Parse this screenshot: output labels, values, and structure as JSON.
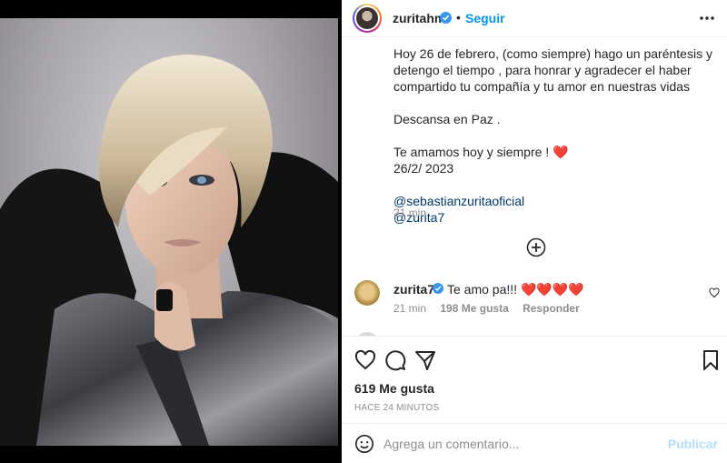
{
  "post": {
    "username": "zuritahm",
    "follow_label": "Seguir",
    "separator": "•",
    "caption": {
      "line1": "Hoy 26 de febrero, (como siempre) hago un paréntesis y detengo el tiempo , para honrar y agradecer el haber compartido tu compañía y tu amor en nuestras vidas",
      "line2": "Descansa en Paz .",
      "line3": "Te amamos hoy y siempre ! ",
      "heart": "❤️",
      "line4": "26/2/ 2023",
      "mention1": "@sebastianzuritaoficial",
      "mention2": "@zurita7"
    },
    "caption_time": "21 min"
  },
  "comment": {
    "username": "zurita7",
    "text": "Te amo pa!!! ",
    "hearts": "❤️❤️❤️❤️",
    "time": "21 min",
    "likes": "198 Me gusta",
    "reply": "Responder"
  },
  "footer": {
    "likes": "619 Me gusta",
    "ago": "HACE 24 MINUTOS",
    "comment_placeholder": "Agrega un comentario...",
    "publish": "Publicar"
  },
  "icons": {
    "verified": "verified-badge-icon",
    "more": "more-options-icon",
    "load_more": "plus-circle-icon",
    "like": "heart-icon",
    "comment": "comment-icon",
    "share": "send-icon",
    "save": "bookmark-icon",
    "emoji": "emoji-icon"
  },
  "colors": {
    "accent": "#0095f6",
    "verified": "#3897f0",
    "mention": "#00376b",
    "heart": "#ed2d3a"
  }
}
